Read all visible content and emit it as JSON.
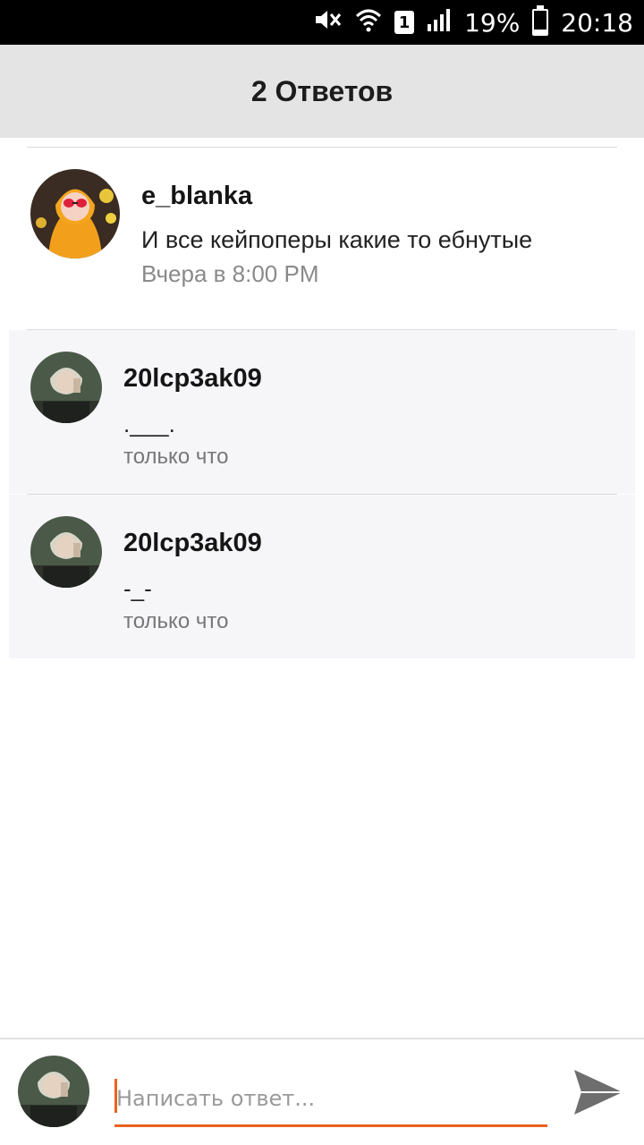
{
  "status_bar": {
    "sim_number": "1",
    "battery_percent": "19%",
    "battery_level": 0.19,
    "time": "20:18",
    "icons": [
      "mute-icon",
      "wifi-icon",
      "sim-icon",
      "signal-icon",
      "battery-icon"
    ]
  },
  "header": {
    "title": "2 Ответов"
  },
  "main_comment": {
    "author": "e_blanka",
    "text": "И все кейпоперы какие то ебнутые",
    "time": "Вчера в 8:00 PM"
  },
  "replies": [
    {
      "author": "20lcp3ak09",
      "text": ".___.",
      "time": "только что"
    },
    {
      "author": "20lcp3ak09",
      "text": "-_-",
      "time": "только что"
    }
  ],
  "composer": {
    "placeholder": "Написать ответ...",
    "value": ""
  },
  "colors": {
    "accent": "#e8641e",
    "header_bg": "#e4e4e4",
    "reply_bg": "#f6f5f8",
    "status_bar_bg": "#000000"
  }
}
